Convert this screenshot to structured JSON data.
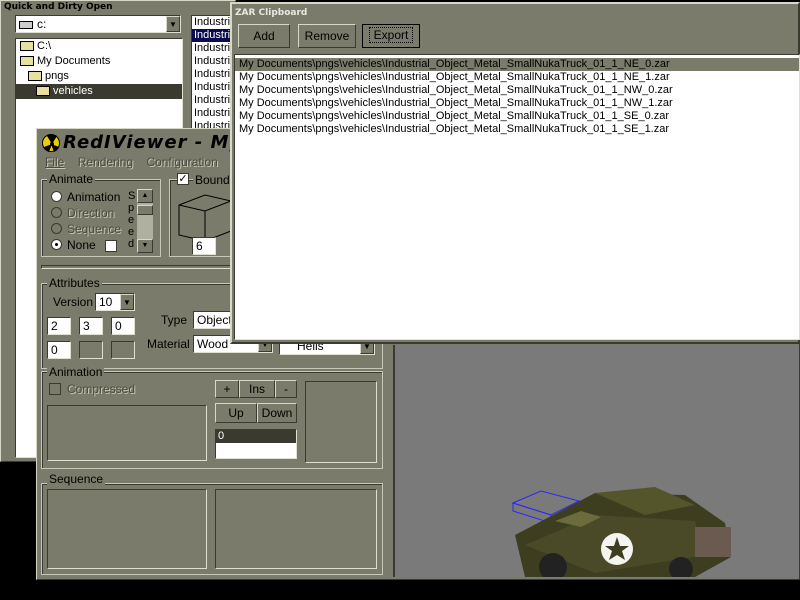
{
  "quick_open": {
    "title": "Quick and Dirty Open",
    "drive": "c:",
    "folders": [
      "C:\\",
      "My Documents",
      "pngs",
      "vehicles"
    ],
    "files": [
      "Industri",
      "Industri",
      "Industri",
      "Industri",
      "Industri",
      "Industri",
      "Industri",
      "Industri",
      "Industri"
    ]
  },
  "viewer": {
    "title": "RedIViewer - My",
    "menu": [
      "File",
      "Rendering",
      "Configuration"
    ],
    "animate": {
      "label": "Animate",
      "options": [
        "Animation",
        "Direction",
        "Sequence",
        "None"
      ],
      "selected": "None",
      "speed_letters": [
        "S",
        "p",
        "e",
        "e",
        "d"
      ]
    },
    "bounding": {
      "label": "Boundin",
      "value": "6"
    },
    "attributes": {
      "label": "Attributes",
      "version_label": "Version",
      "version": "10",
      "fields_row1": [
        "2",
        "3",
        "0"
      ],
      "fields_row2": [
        "0",
        "",
        ""
      ],
      "type_label": "Type",
      "type_value": "Object",
      "material_label": "Material",
      "material_value": "Wood",
      "hells_value": "Hells"
    },
    "animation": {
      "label": "Animation",
      "compressed": "Compressed",
      "buttons": [
        "+",
        "Ins",
        "-"
      ],
      "up": "Up",
      "down": "Down",
      "frame": "0"
    },
    "sequence": {
      "label": "Sequence"
    }
  },
  "clipboard": {
    "title": "ZAR Clipboard",
    "buttons": {
      "add": "Add",
      "remove": "Remove",
      "export": "Export"
    },
    "items": [
      "My Documents\\pngs\\vehicles\\Industrial_Object_Metal_SmallNukaTruck_01_1_NE_0.zar",
      "My Documents\\pngs\\vehicles\\Industrial_Object_Metal_SmallNukaTruck_01_1_NE_1.zar",
      "My Documents\\pngs\\vehicles\\Industrial_Object_Metal_SmallNukaTruck_01_1_NW_0.zar",
      "My Documents\\pngs\\vehicles\\Industrial_Object_Metal_SmallNukaTruck_01_1_NW_1.zar",
      "My Documents\\pngs\\vehicles\\Industrial_Object_Metal_SmallNukaTruck_01_1_SE_0.zar",
      "My Documents\\pngs\\vehicles\\Industrial_Object_Metal_SmallNukaTruck_01_1_SE_1.zar"
    ],
    "selected_index": 0
  },
  "colors": {
    "panel": "#7b7b6b",
    "selection": "#0a0a50",
    "viewport": "#7a7a7a"
  }
}
